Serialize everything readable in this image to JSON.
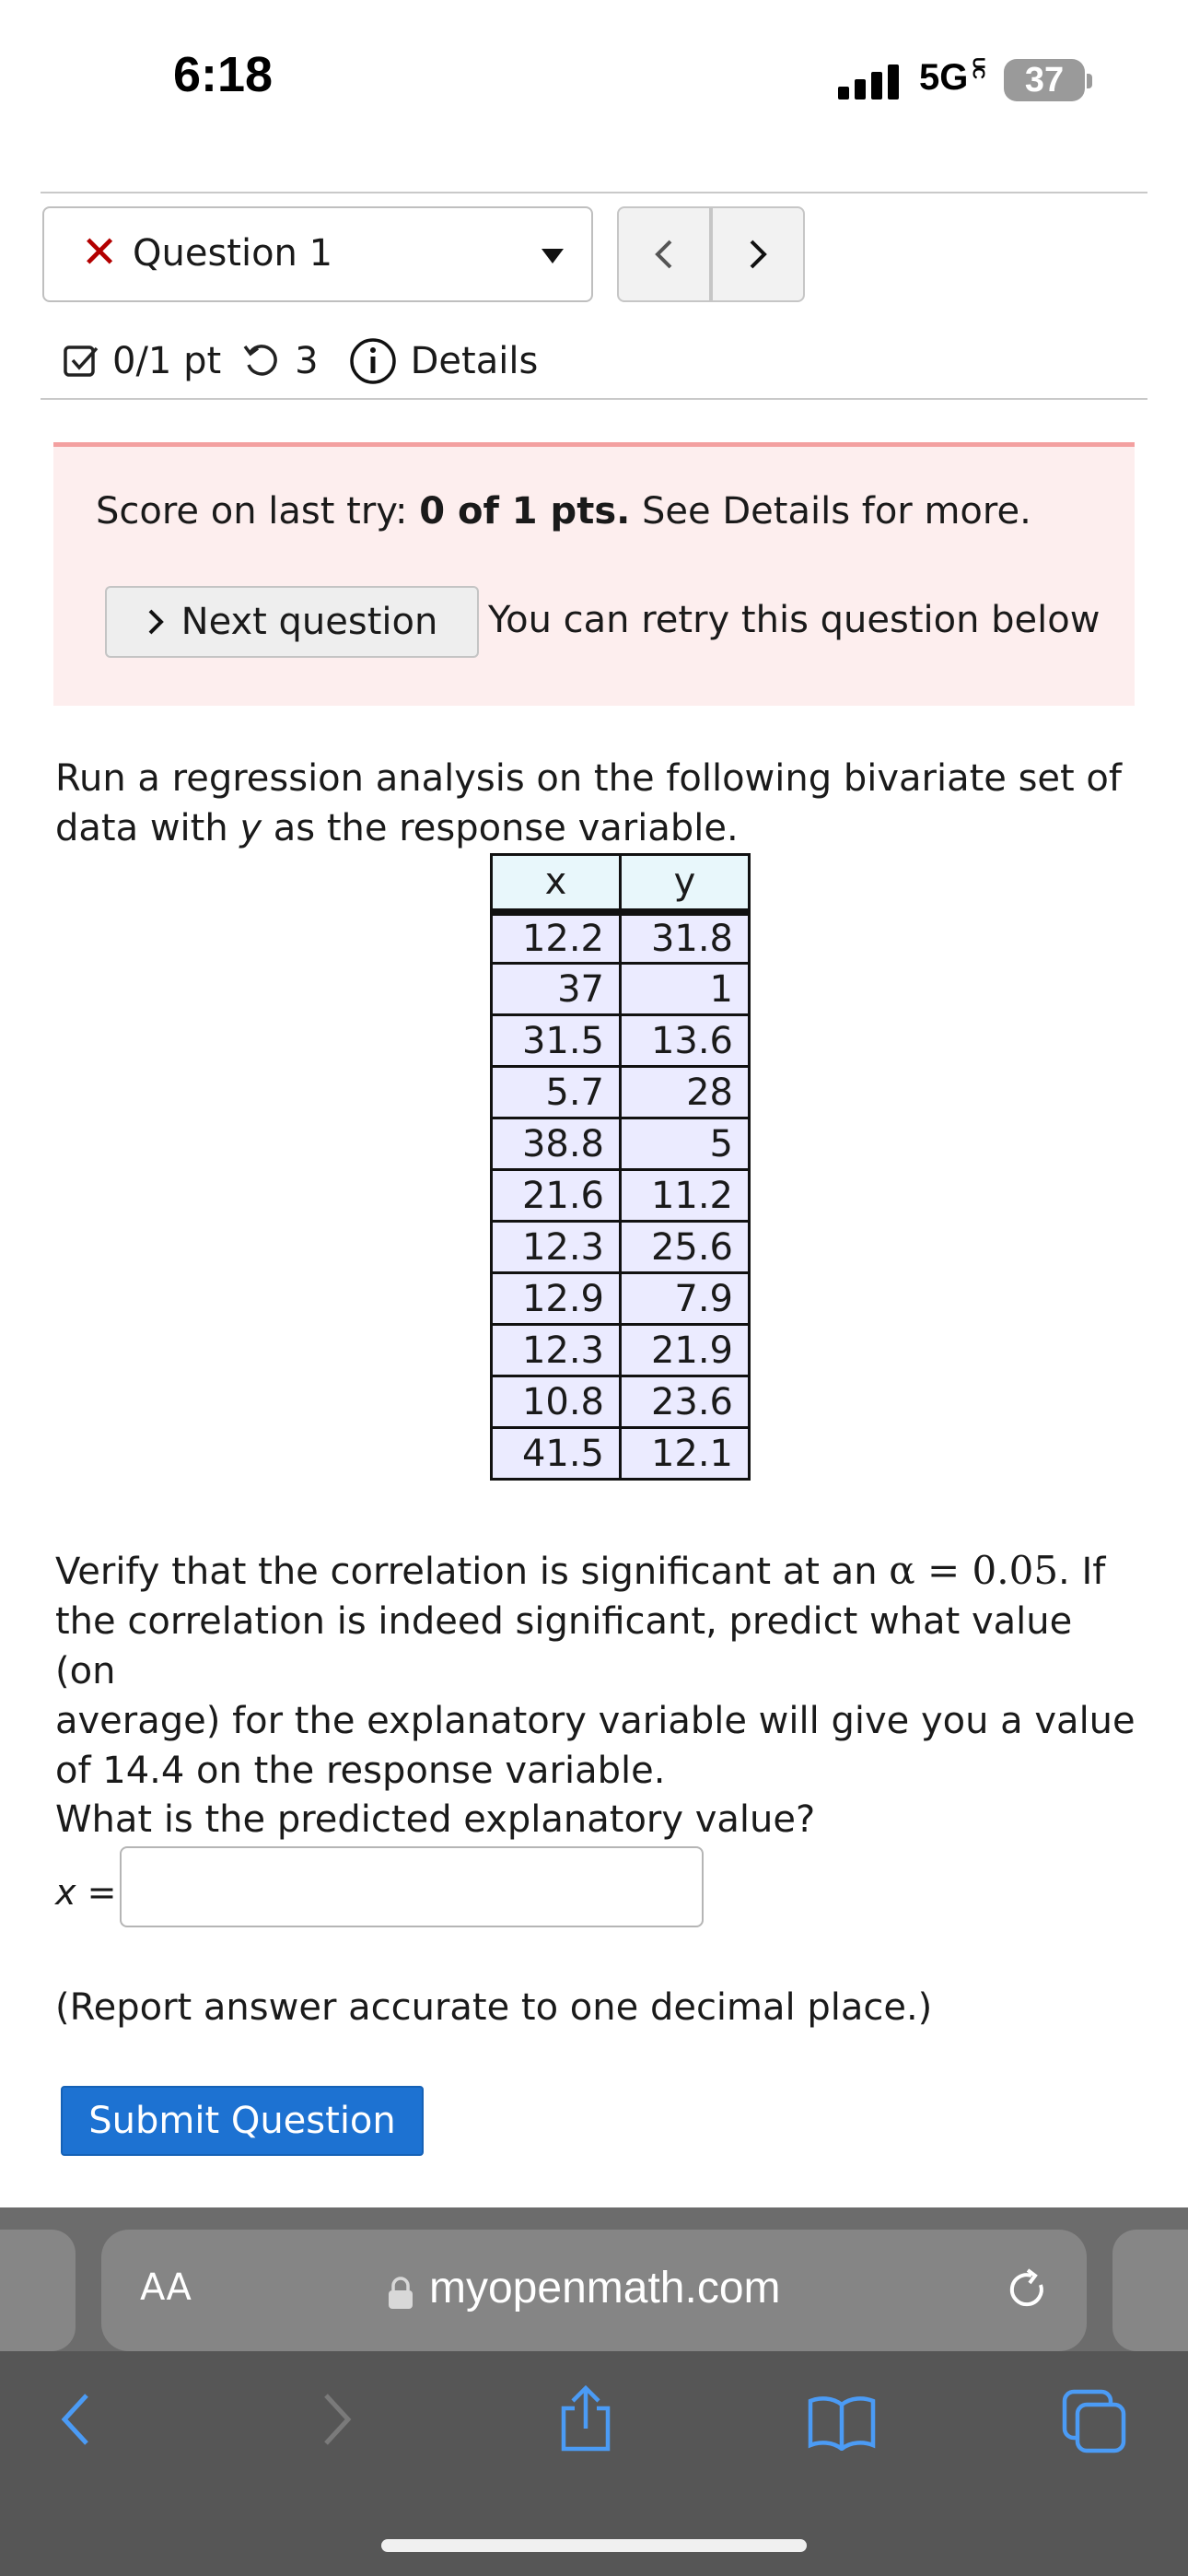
{
  "status_bar": {
    "time": "6:18",
    "network": "5G",
    "network_suffix": "UC",
    "battery": "37"
  },
  "question_nav": {
    "question_label": "Question 1",
    "prev": "<",
    "next": ">"
  },
  "score_row": {
    "score": "0/1 pt",
    "attempts": "3",
    "details": "Details"
  },
  "feedback": {
    "prefix": "Score on last try: ",
    "score_bold": "0 of 1 pts.",
    "suffix": " See Details for more.",
    "next_button": "Next question",
    "retry_text": "You can retry this question below"
  },
  "question": {
    "intro_1": "Run a regression analysis on the following bivariate set of",
    "intro_2a": "data with ",
    "intro_2_var": "y",
    "intro_2b": " as the response variable.",
    "table": {
      "headers": [
        "x",
        "y"
      ],
      "rows": [
        [
          "12.2",
          "31.8"
        ],
        [
          "37",
          "1"
        ],
        [
          "31.5",
          "13.6"
        ],
        [
          "5.7",
          "28"
        ],
        [
          "38.8",
          "5"
        ],
        [
          "21.6",
          "11.2"
        ],
        [
          "12.3",
          "25.6"
        ],
        [
          "12.9",
          "7.9"
        ],
        [
          "12.3",
          "21.9"
        ],
        [
          "10.8",
          "23.6"
        ],
        [
          "41.5",
          "12.1"
        ]
      ]
    },
    "verify_1a": "Verify that the correlation is significant at an ",
    "verify_alpha": "α = 0.05",
    "verify_1b": ". If",
    "verify_2": "the correlation is indeed significant, predict what value (on",
    "verify_3": "average) for the explanatory variable will give you a value",
    "verify_4": "of 14.4 on the response variable.",
    "prompt": "What is the predicted explanatory value?",
    "answer_label": "x =",
    "answer_value": "",
    "note": "(Report answer accurate to one decimal place.)",
    "submit": "Submit Question"
  },
  "browser": {
    "text_size": "AA",
    "url": "myopenmath.com"
  }
}
